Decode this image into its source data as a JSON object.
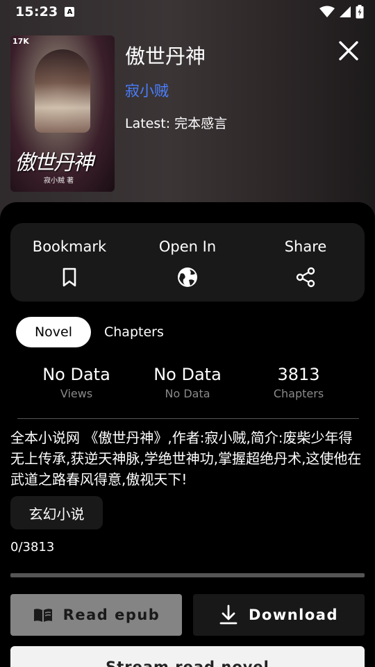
{
  "status_bar": {
    "time": "15:23",
    "notif_letter": "A"
  },
  "book": {
    "title": "傲世丹神",
    "author": "寂小贼",
    "latest": "Latest: 完本感言",
    "cover": {
      "logo": "17K",
      "title_art": "傲世丹神",
      "author_art": "寂小贼 著"
    }
  },
  "actions": {
    "bookmark": "Bookmark",
    "open_in": "Open In",
    "share": "Share"
  },
  "tabs": {
    "novel": "Novel",
    "chapters": "Chapters"
  },
  "stats": [
    {
      "value": "No Data",
      "label": "Views"
    },
    {
      "value": "No Data",
      "label": "No Data"
    },
    {
      "value": "3813",
      "label": "Chapters"
    }
  ],
  "description": "全本小说网 《傲世丹神》,作者:寂小贼,简介:废柴少年得无上传承,获逆天神脉,学绝世神功,掌握超绝丹术,这使他在武道之路春风得意,傲视天下!",
  "genre": "玄幻小说",
  "progress": {
    "text": "0/3813",
    "fraction": 0
  },
  "buttons": {
    "read_epub": "Read epub",
    "download": "Download",
    "stream": "Stream read novel"
  },
  "icons": [
    "bookmark-icon",
    "globe-icon",
    "share-icon",
    "book-open-icon",
    "download-icon",
    "close-icon",
    "wifi-icon",
    "signal-icon",
    "battery-icon"
  ]
}
